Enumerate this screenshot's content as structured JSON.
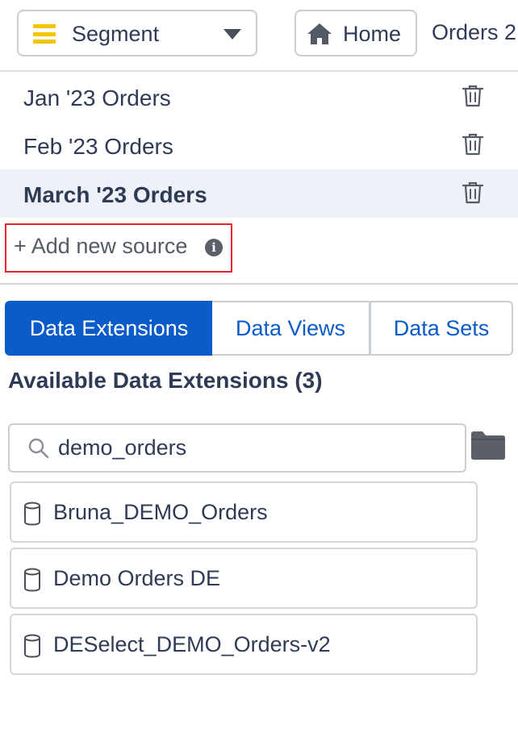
{
  "toolbar": {
    "segment_label": "Segment",
    "home_label": "Home",
    "breadcrumb": "Orders 2"
  },
  "sources": [
    {
      "label": "Jan '23 Orders",
      "active": false
    },
    {
      "label": "Feb '23 Orders",
      "active": false
    },
    {
      "label": "March '23 Orders",
      "active": true
    }
  ],
  "add_source": {
    "label": "+ Add new source"
  },
  "tabs": [
    {
      "label": "Data Extensions",
      "active": true
    },
    {
      "label": "Data Views",
      "active": false
    },
    {
      "label": "Data Sets",
      "active": false
    }
  ],
  "section_title": "Available Data Extensions (3)",
  "search": {
    "value": "demo_orders"
  },
  "data_extensions": [
    {
      "label": "Bruna_DEMO_Orders"
    },
    {
      "label": "Demo Orders DE"
    },
    {
      "label": "DESelect_DEMO_Orders-v2"
    }
  ],
  "colors": {
    "accent": "#0b5cc9",
    "segment_icon": "#f5c400",
    "highlight_border": "#e3262b",
    "active_row": "#eef2f8"
  }
}
